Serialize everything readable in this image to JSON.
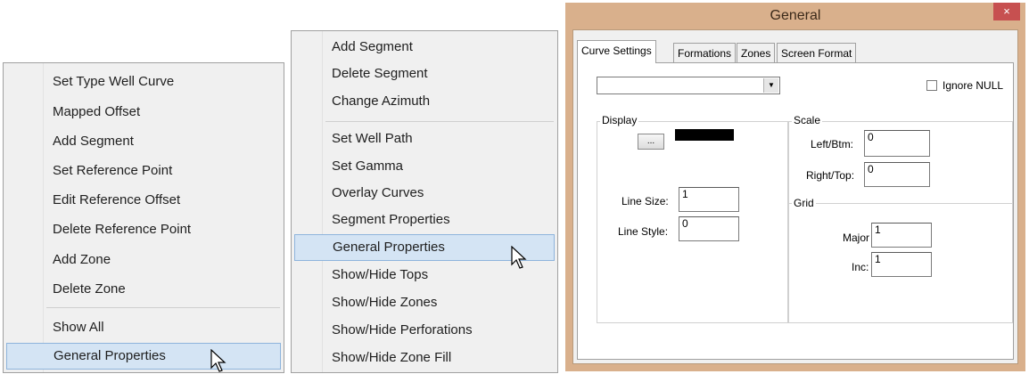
{
  "menu1": {
    "items": [
      "Set Type Well Curve",
      "Mapped Offset",
      "Add Segment",
      "Set Reference Point",
      "Edit Reference Offset",
      "Delete Reference Point",
      "Add Zone",
      "Delete Zone",
      "Show All",
      "General Properties"
    ],
    "highlighted": "General Properties"
  },
  "menu2": {
    "items": [
      "Add Segment",
      "Delete Segment",
      "Change Azimuth",
      "Set Well Path",
      "Set Gamma",
      "Overlay Curves",
      "Segment Properties",
      "General Properties",
      "Show/Hide Tops",
      "Show/Hide Zones",
      "Show/Hide Perforations",
      "Show/Hide Zone Fill"
    ],
    "highlighted": "General Properties"
  },
  "dialog": {
    "title": "General",
    "close": "×",
    "tabs": [
      "Curve Settings",
      "Formations",
      "Zones",
      "Screen Format"
    ],
    "active_tab": "Curve Settings",
    "curve_select": {
      "value": ""
    },
    "ignore_null": {
      "label": "Ignore NULL",
      "checked": false
    },
    "display": {
      "label": "Display",
      "color_button": "...",
      "color": "#000000",
      "line_size_label": "Line Size:",
      "line_size": "1",
      "line_style_label": "Line Style:",
      "line_style": "0"
    },
    "scale": {
      "label": "Scale",
      "left_label": "Left/Btm:",
      "left": "0",
      "right_label": "Right/Top:",
      "right": "0"
    },
    "grid": {
      "label": "Grid",
      "major_label": "Major",
      "major": "1",
      "inc_label": "Inc:",
      "inc": "1"
    }
  },
  "colors": {
    "highlight": "#d4e4f4",
    "titlebar": "#d9b08c",
    "close": "#c75050"
  }
}
